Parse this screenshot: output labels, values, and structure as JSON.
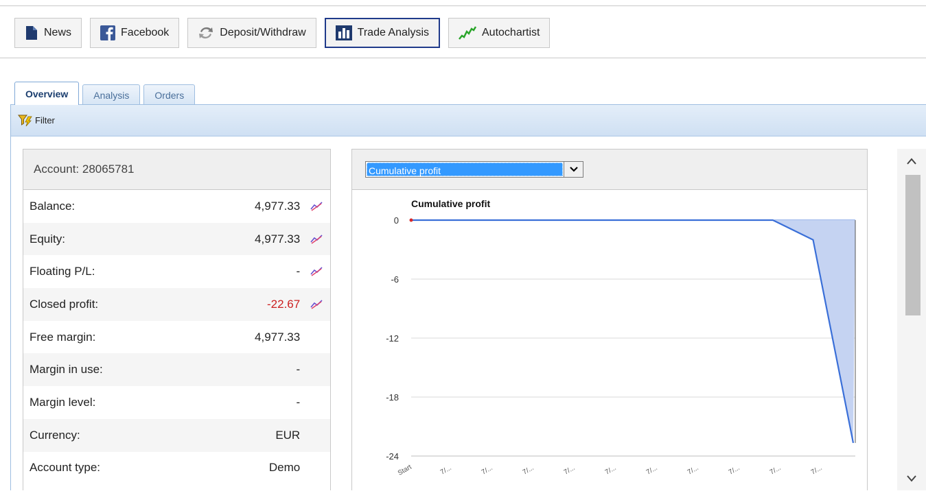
{
  "toolbar": {
    "buttons": [
      {
        "label": "News",
        "icon": "document-icon"
      },
      {
        "label": "Facebook",
        "icon": "facebook-icon"
      },
      {
        "label": "Deposit/Withdraw",
        "icon": "exchange-arrows-icon"
      },
      {
        "label": "Trade Analysis",
        "icon": "bar-chart-icon",
        "active": true
      },
      {
        "label": "Autochartist",
        "icon": "green-trend-icon"
      }
    ]
  },
  "tabs": [
    {
      "label": "Overview",
      "active": true
    },
    {
      "label": "Analysis"
    },
    {
      "label": "Orders"
    }
  ],
  "filter": {
    "label": "Filter",
    "icon": "filter-icon"
  },
  "account": {
    "title": "Account: 28065781",
    "rows": [
      {
        "label": "Balance:",
        "value": "4,977.33",
        "chart_icon": true
      },
      {
        "label": "Equity:",
        "value": "4,977.33",
        "chart_icon": true
      },
      {
        "label": "Floating P/L:",
        "value": "-",
        "chart_icon": true
      },
      {
        "label": "Closed profit:",
        "value": "-22.67",
        "chart_icon": true,
        "negative": true
      },
      {
        "label": "Free margin:",
        "value": "4,977.33"
      },
      {
        "label": "Margin in use:",
        "value": "-"
      },
      {
        "label": "Margin level:",
        "value": "-"
      },
      {
        "label": "Currency:",
        "value": "EUR"
      },
      {
        "label": "Account type:",
        "value": "Demo"
      }
    ]
  },
  "chart_selector": {
    "value": "Cumulative profit"
  },
  "chart_data": {
    "type": "area",
    "title": "Cumulative profit",
    "categories": [
      "Start",
      "7/...",
      "7/...",
      "7/...",
      "7/...",
      "7/...",
      "7/...",
      "7/...",
      "7/...",
      "7/...",
      "7/..."
    ],
    "series": [
      {
        "values": [
          0,
          0,
          0,
          0,
          0,
          0,
          0,
          0,
          0,
          0,
          -2,
          -22.67
        ]
      }
    ],
    "y_ticks": [
      "0",
      "-6",
      "-12",
      "-18",
      "-24"
    ],
    "ylim": [
      -24,
      0
    ],
    "grid": true,
    "colors": {
      "line": "#3a6fd8",
      "fill": "#c5d3f2",
      "start_marker": "#d62a2a"
    }
  },
  "colors": {
    "tab_active_text": "#1a3d6e",
    "negative": "#cc2020",
    "active_button_border": "#1f3a8a"
  }
}
